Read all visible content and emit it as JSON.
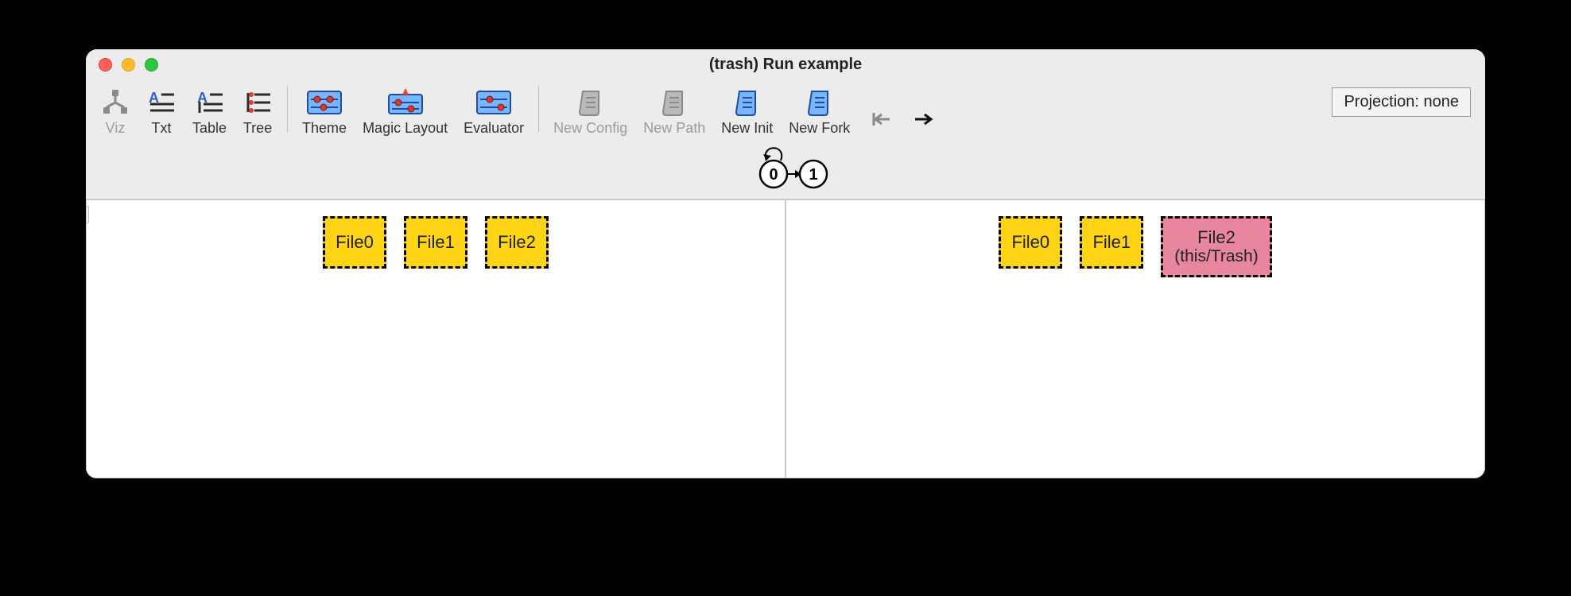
{
  "window": {
    "title": "(trash) Run example"
  },
  "toolbar": {
    "viz": {
      "label": "Viz",
      "enabled": false
    },
    "txt": {
      "label": "Txt",
      "enabled": true
    },
    "table": {
      "label": "Table",
      "enabled": true
    },
    "tree": {
      "label": "Tree",
      "enabled": true
    },
    "theme": {
      "label": "Theme",
      "enabled": true
    },
    "magic_layout": {
      "label": "Magic Layout",
      "enabled": true
    },
    "evaluator": {
      "label": "Evaluator",
      "enabled": true
    },
    "new_config": {
      "label": "New Config",
      "enabled": false
    },
    "new_path": {
      "label": "New Path",
      "enabled": false
    },
    "new_init": {
      "label": "New Init",
      "enabled": true
    },
    "new_fork": {
      "label": "New Fork",
      "enabled": true
    },
    "nav_prev": {
      "enabled": false
    },
    "nav_next": {
      "enabled": true
    }
  },
  "projection": {
    "label": "Projection: none"
  },
  "trace": {
    "states": [
      "0",
      "1"
    ],
    "edges": [
      [
        0,
        1
      ]
    ],
    "self_loop_on": 0
  },
  "panes": [
    {
      "nodes": [
        {
          "label": "File0",
          "kind": "file"
        },
        {
          "label": "File1",
          "kind": "file"
        },
        {
          "label": "File2",
          "kind": "file"
        }
      ]
    },
    {
      "nodes": [
        {
          "label": "File0",
          "kind": "file"
        },
        {
          "label": "File1",
          "kind": "file"
        },
        {
          "label": "File2",
          "sublabel": "(this/Trash)",
          "kind": "trash"
        }
      ]
    }
  ]
}
